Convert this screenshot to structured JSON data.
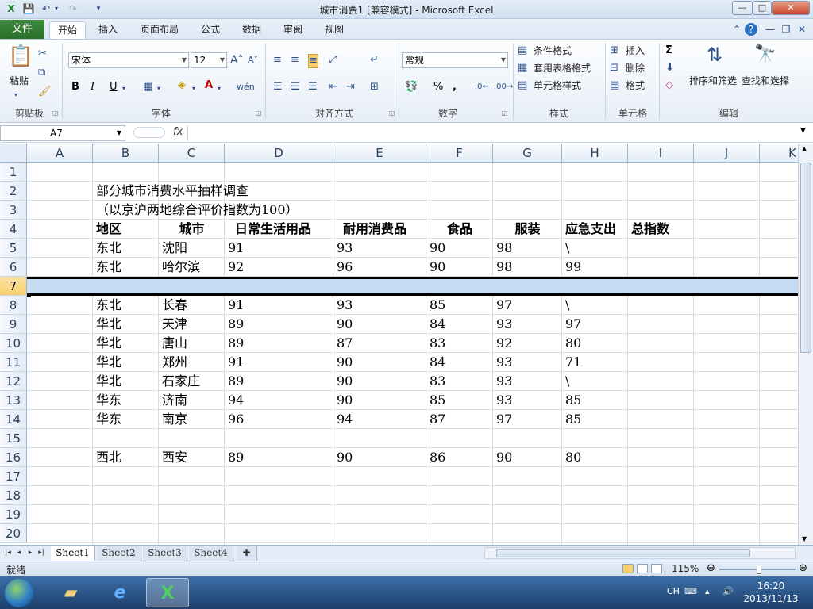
{
  "window": {
    "title": "城市消费1  [兼容模式] - Microsoft Excel",
    "min_label": "—",
    "max_label": "□",
    "close_label": "✕"
  },
  "ribbon": {
    "tabs": [
      {
        "label": "文件"
      },
      {
        "label": "开始"
      },
      {
        "label": "插入"
      },
      {
        "label": "页面布局"
      },
      {
        "label": "公式"
      },
      {
        "label": "数据"
      },
      {
        "label": "审阅"
      },
      {
        "label": "视图"
      }
    ],
    "clipboard": {
      "label": "剪贴板",
      "paste": "粘贴"
    },
    "font": {
      "label": "字体",
      "name": "宋体",
      "size": "12",
      "bold": "B",
      "italic": "I",
      "underline": "U"
    },
    "align": {
      "label": "对齐方式"
    },
    "number": {
      "label": "数字",
      "format": "常规",
      "percent": "%",
      "comma": ","
    },
    "styles": {
      "label": "样式",
      "conditional": "条件格式",
      "table": "套用表格格式",
      "cell": "单元格样式"
    },
    "cells": {
      "label": "单元格",
      "insert": "插入",
      "delete": "删除",
      "format": "格式"
    },
    "editing": {
      "label": "编辑",
      "sort": "排序和筛选",
      "find": "查找和选择",
      "sum": "Σ"
    }
  },
  "formula_bar": {
    "name_box": "A7",
    "fx": "fx",
    "formula": ""
  },
  "columns": [
    "A",
    "B",
    "C",
    "D",
    "E",
    "F",
    "G",
    "H",
    "I",
    "J",
    "K"
  ],
  "rows": [
    "1",
    "2",
    "3",
    "4",
    "5",
    "6",
    "7",
    "8",
    "9",
    "10",
    "11",
    "12",
    "13",
    "14",
    "15",
    "16",
    "17",
    "18",
    "19",
    "20"
  ],
  "cells": {
    "title": "部分城市消费水平抽样调查",
    "subtitle": "（以京沪两地综合评价指数为100）",
    "headers": [
      "地区",
      "城市",
      "日常生活用品",
      "耐用消费品",
      "食品",
      "服装",
      "应急支出",
      "总指数"
    ],
    "data": [
      {
        "row": "5",
        "values": [
          "东北",
          "沈阳",
          "91",
          "93",
          "90",
          "98",
          "\\",
          ""
        ]
      },
      {
        "row": "6",
        "values": [
          "东北",
          "哈尔滨",
          "92",
          "96",
          "90",
          "98",
          "99",
          ""
        ]
      },
      {
        "row": "8",
        "values": [
          "东北",
          "长春",
          "91",
          "93",
          "85",
          "97",
          "\\",
          ""
        ]
      },
      {
        "row": "9",
        "values": [
          "华北",
          "天津",
          "89",
          "90",
          "84",
          "93",
          "97",
          ""
        ]
      },
      {
        "row": "10",
        "values": [
          "华北",
          "唐山",
          "89",
          "87",
          "83",
          "92",
          "80",
          ""
        ]
      },
      {
        "row": "11",
        "values": [
          "华北",
          "郑州",
          "91",
          "90",
          "84",
          "93",
          "71",
          ""
        ]
      },
      {
        "row": "12",
        "values": [
          "华北",
          "石家庄",
          "89",
          "90",
          "83",
          "93",
          "\\",
          ""
        ]
      },
      {
        "row": "13",
        "values": [
          "华东",
          "济南",
          "94",
          "90",
          "85",
          "93",
          "85",
          ""
        ]
      },
      {
        "row": "14",
        "values": [
          "华东",
          "南京",
          "96",
          "94",
          "87",
          "97",
          "85",
          ""
        ]
      },
      {
        "row": "16",
        "values": [
          "西北",
          "西安",
          "89",
          "90",
          "86",
          "90",
          "80",
          ""
        ]
      }
    ]
  },
  "sheets": [
    "Sheet1",
    "Sheet2",
    "Sheet3",
    "Sheet4"
  ],
  "status": {
    "ready": "就绪",
    "zoom": "115%"
  },
  "taskbar": {
    "lang": "CH",
    "time": "16:20",
    "date": "2013/11/13"
  }
}
